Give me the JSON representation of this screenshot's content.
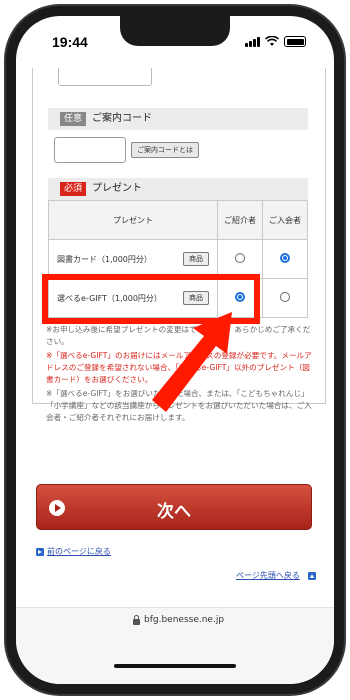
{
  "status_bar": {
    "time": "19:44"
  },
  "sections": {
    "referral": {
      "tag": "任意",
      "title": "ご案内コード",
      "button": "ご案内コードとは"
    },
    "present": {
      "tag": "必須",
      "title": "プレゼント"
    }
  },
  "table": {
    "headers": [
      "プレゼント",
      "ご紹介者",
      "ご入会者"
    ],
    "rows": [
      {
        "name": "図書カード（1,000円分）",
        "button": "商品",
        "referrer_selected": false,
        "member_selected": true
      },
      {
        "name": "選べるe-GIFT（1,000円分）",
        "button": "商品",
        "referrer_selected": true,
        "member_selected": false
      }
    ]
  },
  "notes": [
    {
      "style": "grey",
      "text": "※お申し込み後に希望プレゼントの変更はできません。あらかじめご了承ください。"
    },
    {
      "style": "red",
      "text": "※「選べるe-GIFT」のお届けにはメールアドレスの登録が必要です。メールアドレスのご登録を希望されない場合、「選べるe-GIFT」以外のプレゼント（図書カード）をお選びください。"
    },
    {
      "style": "grey",
      "text": "※「選べるe-GIFT」をお選びいただいた場合、または、「こどもちゃれんじ」「小学講座」などの該当講座からプレゼントをお選びいただいた場合は、ご入会者・ご紹介者それぞれにお届けします。"
    }
  ],
  "next_button": "次へ",
  "links": {
    "back": "前のページに戻る",
    "top": "ページ先頭へ戻る"
  },
  "browser": {
    "url": "bfg.benesse.ne.jp"
  },
  "colors": {
    "accent_red": "#d9251c",
    "radio_blue": "#1f6fe0",
    "annotation_red": "#ff1a00"
  }
}
